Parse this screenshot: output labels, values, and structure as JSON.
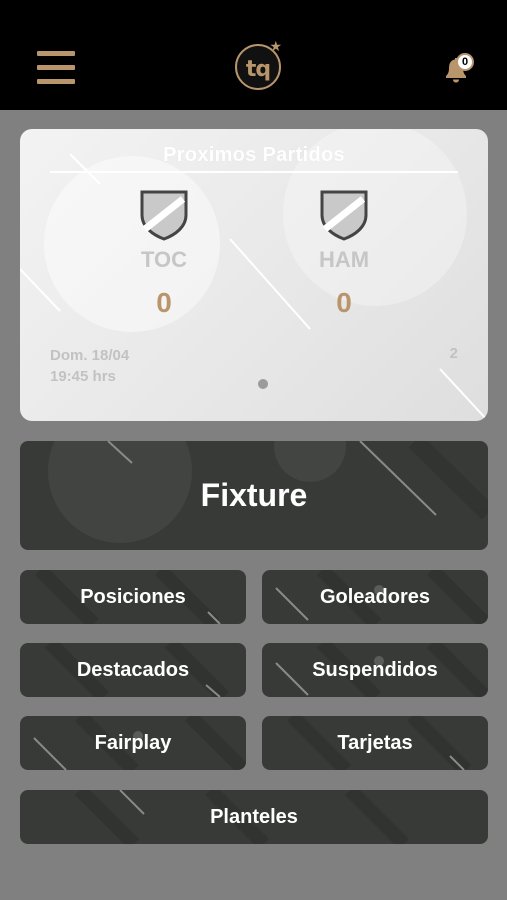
{
  "header": {
    "menu_icon": "hamburger-menu-icon",
    "logo_text": "tq",
    "logo_star": "★",
    "bell_icon": "bell-icon",
    "notification_count": "0",
    "accent_color": "#b8956a"
  },
  "match_card": {
    "title": "Proximos Partidos",
    "home": {
      "name": "TOC",
      "score": "0",
      "crest_icon": "shield-icon"
    },
    "away": {
      "name": "HAM",
      "score": "0",
      "crest_icon": "shield-icon"
    },
    "date": "Dom. 18/04",
    "time": "19:45 hrs",
    "round": "2"
  },
  "menu": {
    "fixture": "Fixture",
    "posiciones": "Posiciones",
    "goleadores": "Goleadores",
    "destacados": "Destacados",
    "suspendidos": "Suspendidos",
    "fairplay": "Fairplay",
    "tarjetas": "Tarjetas",
    "planteles": "Planteles"
  }
}
